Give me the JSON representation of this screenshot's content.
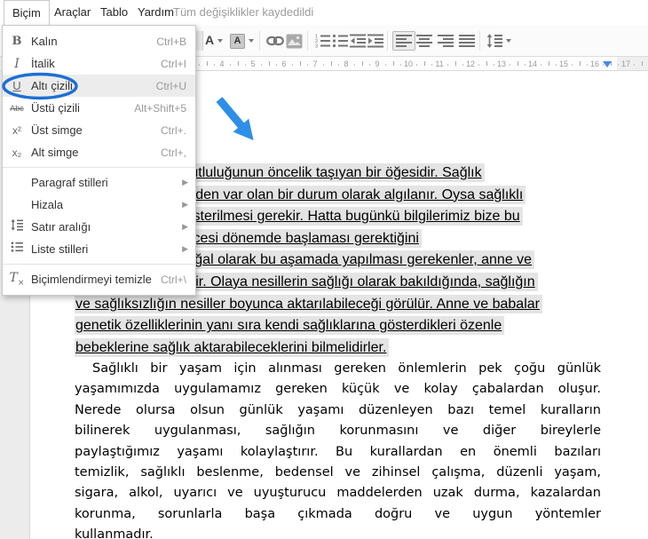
{
  "menubar": {
    "items": [
      {
        "label": "Biçim",
        "active": true
      },
      {
        "label": "Araçlar",
        "active": false
      },
      {
        "label": "Tablo",
        "active": false
      },
      {
        "label": "Yardım",
        "active": false
      }
    ],
    "status": "Tüm değişiklikler kaydedildi"
  },
  "toolbar": {
    "text_color_glyph": "A",
    "highlight_glyph": "A",
    "icons": [
      "text-color",
      "highlight-color",
      "insert-link",
      "insert-image",
      "numbered-list",
      "bulleted-list",
      "decrease-indent",
      "increase-indent",
      "align-left",
      "align-center",
      "align-right",
      "justify",
      "line-spacing"
    ],
    "active_icon": "align-left"
  },
  "ruler": {
    "min": 3,
    "max": 17,
    "marker_color": "#4a86e8"
  },
  "format_menu": {
    "items": [
      {
        "glyph": "B",
        "label": "Kalın",
        "shortcut": "Ctrl+B"
      },
      {
        "glyph": "I",
        "label": "İtalik",
        "shortcut": "Ctrl+I"
      },
      {
        "glyph": "U",
        "label": "Altı çizili",
        "shortcut": "Ctrl+U",
        "highlighted": true
      },
      {
        "glyph": "Abc",
        "label": "Üstü çizili",
        "shortcut": "Alt+Shift+5"
      },
      {
        "glyph": "x²",
        "label": "Üst simge",
        "shortcut": "Ctrl+."
      },
      {
        "glyph": "x₂",
        "label": "Alt simge",
        "shortcut": "Ctrl+,"
      },
      {
        "glyph": "",
        "label": "Paragraf stilleri",
        "submenu": true
      },
      {
        "glyph": "",
        "label": "Hizala",
        "submenu": true
      },
      {
        "glyph": "",
        "label": "Satır aralığı",
        "submenu": true
      },
      {
        "glyph": "",
        "label": "Liste stilleri",
        "submenu": true
      },
      {
        "glyph": "T",
        "label": "Biçimlendirmeyi temizle",
        "shortcut": "Ctrl+\\"
      }
    ],
    "submenu_arrow": "▶"
  },
  "annotations": {
    "ellipse_color": "#1d6fd4",
    "arrow_color": "#2e8fe8"
  },
  "document": {
    "para1": {
      "lines": [
        "Sağlık, insan mutluluğunun öncelik taşıyan bir öğesidir. Sağlık",
        "çoğu kez kendiliğinden var olan bir durum olarak algılanır. Oysa sağlıklı",
        "olmak için çaba gösterilmesi gerekir. Hatta bugünkü bilgilerimiz bize bu",
        "çabanın doğum öncesi dönemde başlaması gerektiğini",
        "göstermektedir. Doğal olarak bu aşamada yapılması gerekenler, anne ve",
        "babaya düşmektedir. Olaya nesillerin sağlığı olarak bakıldığında, sağlığın",
        "ve sağlıksızlığın nesiller boyunca aktarılabileceği görülür. Anne ve babalar",
        "genetik özelliklerinin yanı sıra kendi sağlıklarına gösterdikleri özenle",
        "bebeklerine sağlık aktarabileceklerini bilmelidirler."
      ]
    },
    "para2": {
      "lines": [
        "Sağlıklı bir yaşam için alınması gereken önlemlerin pek çoğu günlük",
        "yaşamımızda uygulamamız gereken küçük ve kolay çabalardan oluşur.",
        "Nerede olursa olsun günlük yaşamı düzenleyen bazı temel kuralların",
        "bilinerek uygulanması, sağlığın korunmasını ve diğer bireylerle",
        "paylaştığımız yaşamı kolaylaştırır. Bu kurallardan en önemli bazıları",
        "temizlik, sağlıklı beslenme, bedensel ve zihinsel çalışma, düzenli yaşam,",
        "sigara, alkol, uyarıcı ve uyuşturucu maddelerden uzak durma, kazalardan",
        "korunma, sorunlarla başa çıkmada doğru ve uygun yöntemler",
        "kullanmadır."
      ]
    }
  }
}
